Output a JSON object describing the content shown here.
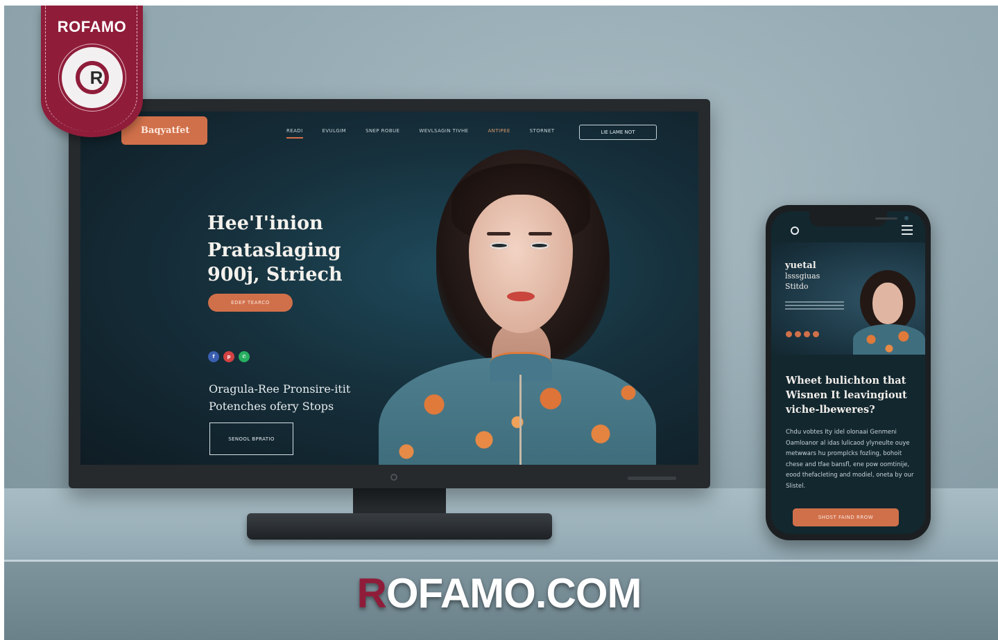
{
  "watermark": {
    "badge_text": "ROFAMO",
    "wordmark_first": "R",
    "wordmark_rest": "OFAMO.COM",
    "brand_color": "#8f1d3a"
  },
  "desktop": {
    "logo": "Baqyatfet",
    "nav": [
      "READI",
      "EVULGIM",
      "SNEP ROBUE",
      "WEVLSAGIN TIVHE",
      "ANTIPEE",
      "STORNET"
    ],
    "nav_cta": "LIE    LAME NOT",
    "hero_title_line1": "Hee'I'inion",
    "hero_title_line2": "Prataslaging",
    "hero_title_line3": "900j, Striech",
    "hero_button": "EDEP TEARCO",
    "social_icons": [
      "facebook-icon",
      "pinterest-icon",
      "whatsapp-icon"
    ],
    "hero_sub_line1": "Oragula-Ree Pronsire-itit",
    "hero_sub_line2": "Potenches ofery Stops",
    "outline_button": "SENOOL BPRATIO",
    "accent_color": "#d0704a"
  },
  "mobile": {
    "hero_title_line1": "yuetal",
    "hero_title_line2": "lsssgiuas",
    "hero_title_line3": "Stitdo",
    "heading_line1": "Wheet bulichton that",
    "heading_line2": "Wisnen It leavingiout",
    "heading_line3": "viche-lbeweres?",
    "body": "Chdu vobtes Ity idel olonaai Genmeni Oamloanor al idas lulicaod ylyneulte ouye metwwars hu promplcks fozling, bohoit chese and tfae bansfl, ene pow oomtinije, eood thefacleting and modiel, oneta by our Slistel.",
    "button": "SHOST FAIND RROW"
  }
}
